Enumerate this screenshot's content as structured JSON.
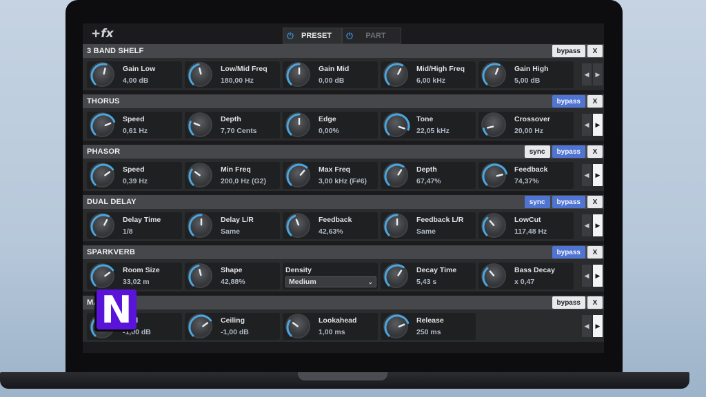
{
  "app": {
    "logo": "+fx",
    "tabs": [
      {
        "label": "PRESET",
        "active": true
      },
      {
        "label": "PART",
        "active": false
      }
    ]
  },
  "colors": {
    "accent": "#4f74d1",
    "knob_arc": "#4aa6e0"
  },
  "modules": [
    {
      "title": "3 BAND SHELF",
      "buttons": [
        "bypass",
        "X"
      ],
      "params": [
        {
          "name": "Gain Low",
          "value": "4,00 dB",
          "level": 0.55
        },
        {
          "name": "Low/Mid Freq",
          "value": "180,00 Hz",
          "level": 0.45
        },
        {
          "name": "Gain Mid",
          "value": "0,00 dB",
          "level": 0.5
        },
        {
          "name": "Mid/High Freq",
          "value": "6,00 kHz",
          "level": 0.6
        },
        {
          "name": "Gain High",
          "value": "5,00 dB",
          "level": 0.58
        }
      ]
    },
    {
      "title": "THORUS",
      "buttons": [
        "bypass",
        "X"
      ],
      "params": [
        {
          "name": "Speed",
          "value": "0,61 Hz",
          "level": 0.75
        },
        {
          "name": "Depth",
          "value": "7,70 Cents",
          "level": 0.25
        },
        {
          "name": "Edge",
          "value": "0,00%",
          "level": 0.5
        },
        {
          "name": "Tone",
          "value": "22,05 kHz",
          "level": 0.9
        },
        {
          "name": "Crossover",
          "value": "20,00 Hz",
          "level": 0.12
        }
      ]
    },
    {
      "title": "PHASOR",
      "buttons": [
        "sync",
        "bypass",
        "X"
      ],
      "params": [
        {
          "name": "Speed",
          "value": "0,39 Hz",
          "level": 0.7
        },
        {
          "name": "Min Freq",
          "value": "200,0 Hz (G2)",
          "level": 0.3
        },
        {
          "name": "Max Freq",
          "value": "3,00 kHz (F#6)",
          "level": 0.65
        },
        {
          "name": "Depth",
          "value": "67,47%",
          "level": 0.62
        },
        {
          "name": "Feedback",
          "value": "74,37%",
          "level": 0.78
        }
      ]
    },
    {
      "title": "DUAL DELAY",
      "buttons": [
        "sync",
        "bypass",
        "X"
      ],
      "params": [
        {
          "name": "Delay Time",
          "value": "1/8",
          "level": 0.6
        },
        {
          "name": "Delay L/R",
          "value": "Same",
          "level": 0.5
        },
        {
          "name": "Feedback",
          "value": "42,63%",
          "level": 0.42
        },
        {
          "name": "Feedback L/R",
          "value": "Same",
          "level": 0.5
        },
        {
          "name": "LowCut",
          "value": "117,48 Hz",
          "level": 0.35
        }
      ]
    },
    {
      "title": "SPARKVERB",
      "buttons": [
        "bypass",
        "X"
      ],
      "params": [
        {
          "name": "Room Size",
          "value": "33,02 m",
          "level": 0.7
        },
        {
          "name": "Shape",
          "value": "42,88%",
          "level": 0.45
        },
        {
          "name": "Density",
          "value": "Medium",
          "type": "select"
        },
        {
          "name": "Decay Time",
          "value": "5,43 s",
          "level": 0.62
        },
        {
          "name": "Bass Decay",
          "value": "x 0,47",
          "level": 0.35
        }
      ]
    },
    {
      "title": "MA",
      "buttons": [
        "bypass",
        "X"
      ],
      "params": [
        {
          "name": "hold",
          "value": "-1,00 dB",
          "level": 0.6
        },
        {
          "name": "Ceiling",
          "value": "-1,00 dB",
          "level": 0.7
        },
        {
          "name": "Lookahead",
          "value": "1,00 ms",
          "level": 0.3
        },
        {
          "name": "Release",
          "value": "250 ms",
          "level": 0.75
        }
      ]
    }
  ],
  "overlay_logo": "N"
}
